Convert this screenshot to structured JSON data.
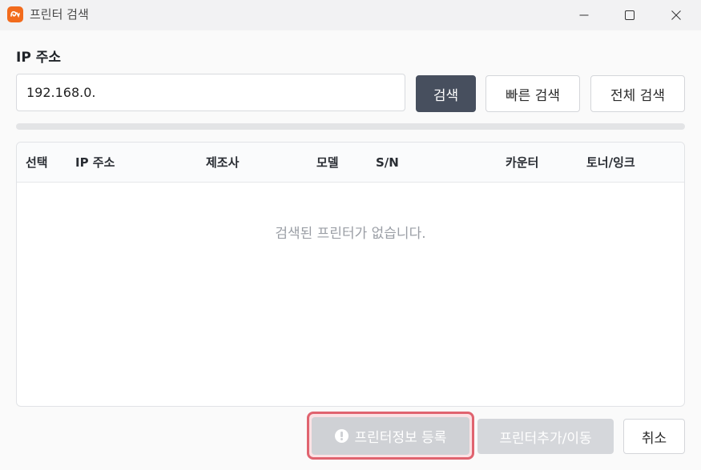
{
  "window": {
    "title": "프린터 검색",
    "accent_color": "#f26b1d"
  },
  "ip_section": {
    "label": "IP 주소",
    "input_value": "192.168.0."
  },
  "buttons": {
    "search": "검색",
    "quick_search": "빠른 검색",
    "full_search": "전체 검색",
    "register_info": "프린터정보 등록",
    "add_move": "프린터추가/이동",
    "cancel": "취소"
  },
  "progress": {
    "value": 0
  },
  "table": {
    "columns": [
      "선택",
      "IP 주소",
      "제조사",
      "모델",
      "S/N",
      "카운터",
      "토너/잉크"
    ],
    "rows": [],
    "empty_message": "검색된 프린터가 없습니다."
  },
  "colors": {
    "primary_button": "#474f5e",
    "disabled_button": "#cfd1d5",
    "highlight_outline": "#e0636f"
  }
}
